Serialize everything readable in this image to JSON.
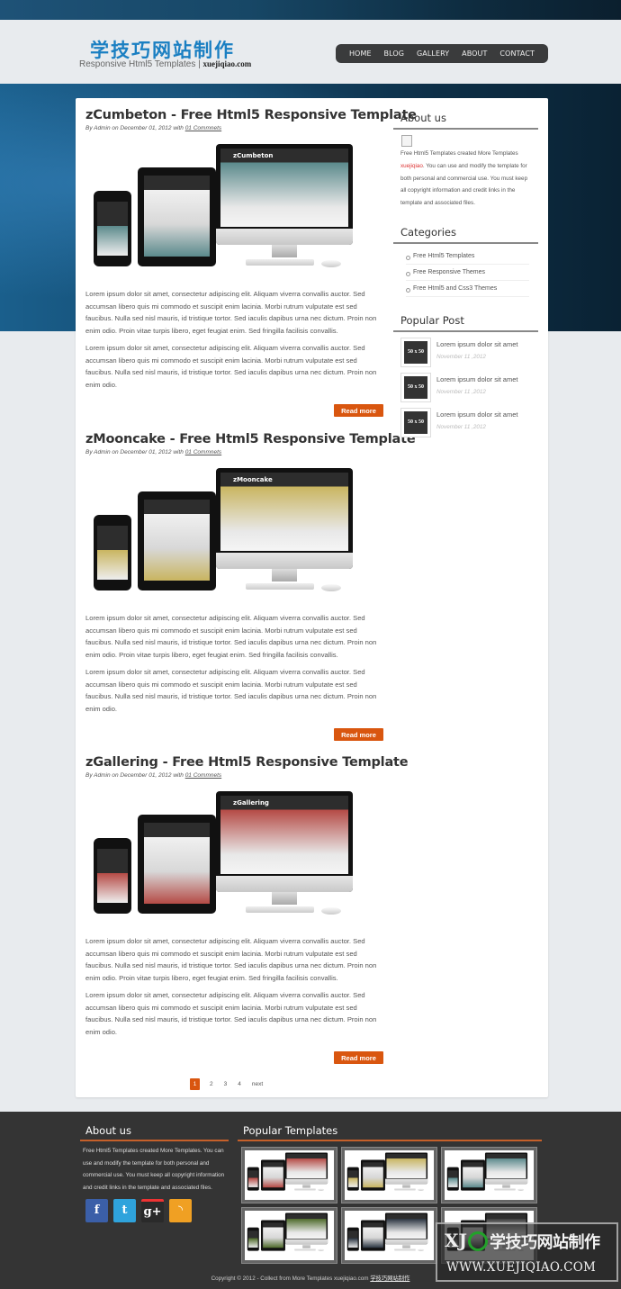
{
  "header": {
    "logo_cn": "学技巧网站制作",
    "logo_sub": "Responsive Html5 Templates |",
    "logo_domain": "xuejiqiao.com"
  },
  "nav": {
    "items": [
      {
        "label": "HOME"
      },
      {
        "label": "BLOG"
      },
      {
        "label": "GALLERY"
      },
      {
        "label": "ABOUT"
      },
      {
        "label": "CONTACT"
      }
    ]
  },
  "posts": [
    {
      "title": "zCumbeton - Free Html5 Responsive Template",
      "meta_prefix": "By Admin on December 01, 2012 with",
      "comments": "01 Commnets",
      "image_label": "zCumbeton",
      "paragraphs": [
        "Lorem ipsum dolor sit amet, consectetur adipiscing elit. Aliquam viverra convallis auctor. Sed accumsan libero quis mi commodo et suscipit enim lacinia. Morbi rutrum vulputate est sed faucibus. Nulla sed nisl mauris, id tristique tortor. Sed iaculis dapibus urna nec dictum. Proin non enim odio. Proin vitae turpis libero, eget feugiat enim. Sed fringilla facilisis convallis.",
        "Lorem ipsum dolor sit amet, consectetur adipiscing elit. Aliquam viverra convallis auctor. Sed accumsan libero quis mi commodo et suscipit enim lacinia. Morbi rutrum vulputate est sed faucibus. Nulla sed nisl mauris, id tristique tortor. Sed iaculis dapibus urna nec dictum. Proin non enim odio."
      ],
      "read_more": "Read more",
      "screen_color": "#5b8a8c"
    },
    {
      "title": "zMooncake - Free Html5 Responsive Template",
      "meta_prefix": "By Admin on December 01, 2012 with",
      "comments": "01 Commnets",
      "image_label": "zMooncake",
      "paragraphs": [
        "Lorem ipsum dolor sit amet, consectetur adipiscing elit. Aliquam viverra convallis auctor. Sed accumsan libero quis mi commodo et suscipit enim lacinia. Morbi rutrum vulputate est sed faucibus. Nulla sed nisl mauris, id tristique tortor. Sed iaculis dapibus urna nec dictum. Proin non enim odio. Proin vitae turpis libero, eget feugiat enim. Sed fringilla facilisis convallis.",
        "Lorem ipsum dolor sit amet, consectetur adipiscing elit. Aliquam viverra convallis auctor. Sed accumsan libero quis mi commodo et suscipit enim lacinia. Morbi rutrum vulputate est sed faucibus. Nulla sed nisl mauris, id tristique tortor. Sed iaculis dapibus urna nec dictum. Proin non enim odio."
      ],
      "read_more": "Read more",
      "screen_color": "#c9b560"
    },
    {
      "title": "zGallering - Free Html5 Responsive Template",
      "meta_prefix": "By Admin on December 01, 2012 with",
      "comments": "01 Commnets",
      "image_label": "zGallering",
      "paragraphs": [
        "Lorem ipsum dolor sit amet, consectetur adipiscing elit. Aliquam viverra convallis auctor. Sed accumsan libero quis mi commodo et suscipit enim lacinia. Morbi rutrum vulputate est sed faucibus. Nulla sed nisl mauris, id tristique tortor. Sed iaculis dapibus urna nec dictum. Proin non enim odio. Proin vitae turpis libero, eget feugiat enim. Sed fringilla facilisis convallis.",
        "Lorem ipsum dolor sit amet, consectetur adipiscing elit. Aliquam viverra convallis auctor. Sed accumsan libero quis mi commodo et suscipit enim lacinia. Morbi rutrum vulputate est sed faucibus. Nulla sed nisl mauris, id tristique tortor. Sed iaculis dapibus urna nec dictum. Proin non enim odio."
      ],
      "read_more": "Read more",
      "screen_color": "#b54a45"
    }
  ],
  "pagination": {
    "pages": [
      "1",
      "2",
      "3",
      "4"
    ],
    "active": "1",
    "next": "next"
  },
  "sidebar": {
    "about": {
      "title": "About us",
      "text_before": "Free Html5 Templates created More Templates",
      "link": "xuejiqiao",
      "text_after": ". You can use and modify the template for both personal and commercial use. You must keep all copyright information and credit links in the template and associated files."
    },
    "categories": {
      "title": "Categories",
      "items": [
        {
          "label": "Free Html5 Templates"
        },
        {
          "label": "Free Responsive Themes"
        },
        {
          "label": "Free Html5 and Css3 Themes"
        }
      ]
    },
    "popular": {
      "title": "Popular Post",
      "items": [
        {
          "thumb": "50 x 50",
          "title": "Lorem ipsum dolor sit amet",
          "date": "November 11 ,2012"
        },
        {
          "thumb": "50 x 50",
          "title": "Lorem ipsum dolor sit amet",
          "date": "November 11 ,2012"
        },
        {
          "thumb": "50 x 50",
          "title": "Lorem ipsum dolor sit amet",
          "date": "November 11 ,2012"
        }
      ]
    }
  },
  "footer": {
    "about": {
      "title": "About us",
      "text": "Free Html5 Templates created More Templates. You can use and modify the template for both personal and commercial use. You must keep all copyright information and credit links in the template and associated files."
    },
    "social": [
      {
        "name": "facebook",
        "glyph": "f",
        "color": "#3b5fa8"
      },
      {
        "name": "twitter",
        "glyph": "t",
        "color": "#2fa3dc"
      },
      {
        "name": "google-plus",
        "glyph": "g+",
        "color": "#2a2a2a"
      },
      {
        "name": "rss",
        "glyph": "◝",
        "color": "#f0a023"
      }
    ],
    "popular_templates": {
      "title": "Popular Templates",
      "items": [
        {
          "screen_color": "#b54a45"
        },
        {
          "screen_color": "#c9b560"
        },
        {
          "screen_color": "#5b8a8c"
        },
        {
          "screen_color": "#4e6a2a"
        },
        {
          "screen_color": "#2a3440"
        },
        {
          "screen_color": "#3a3a3a"
        }
      ]
    },
    "copyright": "Copyright © 2012 - Collect from More Templates xuejiqiao.com",
    "copyright_link": "学技巧网站制作"
  },
  "watermark": {
    "logo": "XJ",
    "cn": "学技巧网站制作",
    "url": "WWW.XUEJIQIAO.COM"
  }
}
